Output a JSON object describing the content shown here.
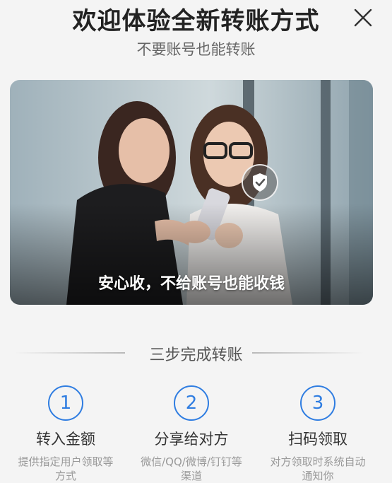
{
  "header": {
    "title": "欢迎体验全新转账方式",
    "subtitle": "不要账号也能转账"
  },
  "hero": {
    "caption": "安心收，不给账号也能收钱"
  },
  "section": {
    "title": "三步完成转账"
  },
  "steps": [
    {
      "number": "1",
      "title": "转入金额",
      "desc": "提供指定用户领取等方式"
    },
    {
      "number": "2",
      "title": "分享给对方",
      "desc": "微信/QQ/微博/钉钉等渠道"
    },
    {
      "number": "3",
      "title": "扫码领取",
      "desc": "对方领取时系统自动通知你"
    }
  ],
  "colors": {
    "accent": "#2f7de1",
    "background": "#f4f4f4"
  },
  "icons": {
    "close": "close-icon",
    "shield": "shield-check-icon"
  }
}
